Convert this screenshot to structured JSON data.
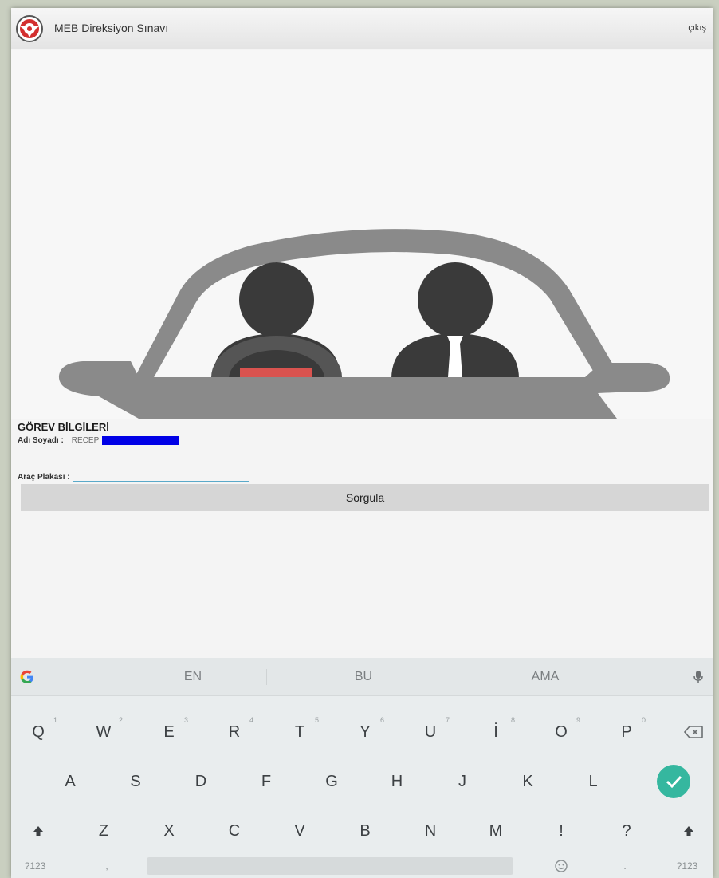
{
  "app": {
    "title": "MEB Direksiyon Sınavı",
    "exit_label": "çıkış",
    "brand_color": "#d32f2f"
  },
  "form": {
    "section_title": "GÖREV BİLGİLERİ",
    "name_label": "Adı Soyadı :",
    "name_value": "RECEP",
    "redaction_color": "#0000e6",
    "plate_label": "Araç Plakası :",
    "plate_value": "",
    "query_button": "Sorgula"
  },
  "keyboard": {
    "suggestions": [
      "EN",
      "BU",
      "AMA"
    ],
    "row1": [
      {
        "label": "Q",
        "hint": "1"
      },
      {
        "label": "W",
        "hint": "2"
      },
      {
        "label": "E",
        "hint": "3"
      },
      {
        "label": "R",
        "hint": "4"
      },
      {
        "label": "T",
        "hint": "5"
      },
      {
        "label": "Y",
        "hint": "6"
      },
      {
        "label": "U",
        "hint": "7"
      },
      {
        "label": "İ",
        "hint": "8"
      },
      {
        "label": "O",
        "hint": "9"
      },
      {
        "label": "P",
        "hint": "0"
      }
    ],
    "row2": [
      "A",
      "S",
      "D",
      "F",
      "G",
      "H",
      "J",
      "K",
      "L"
    ],
    "row3": [
      "Z",
      "X",
      "C",
      "V",
      "B",
      "N",
      "M",
      "!",
      "?"
    ],
    "symbols_left": "?123",
    "symbols_right": "?123",
    "comma": ",",
    "period": ".",
    "accent_color": "#35b79f"
  }
}
